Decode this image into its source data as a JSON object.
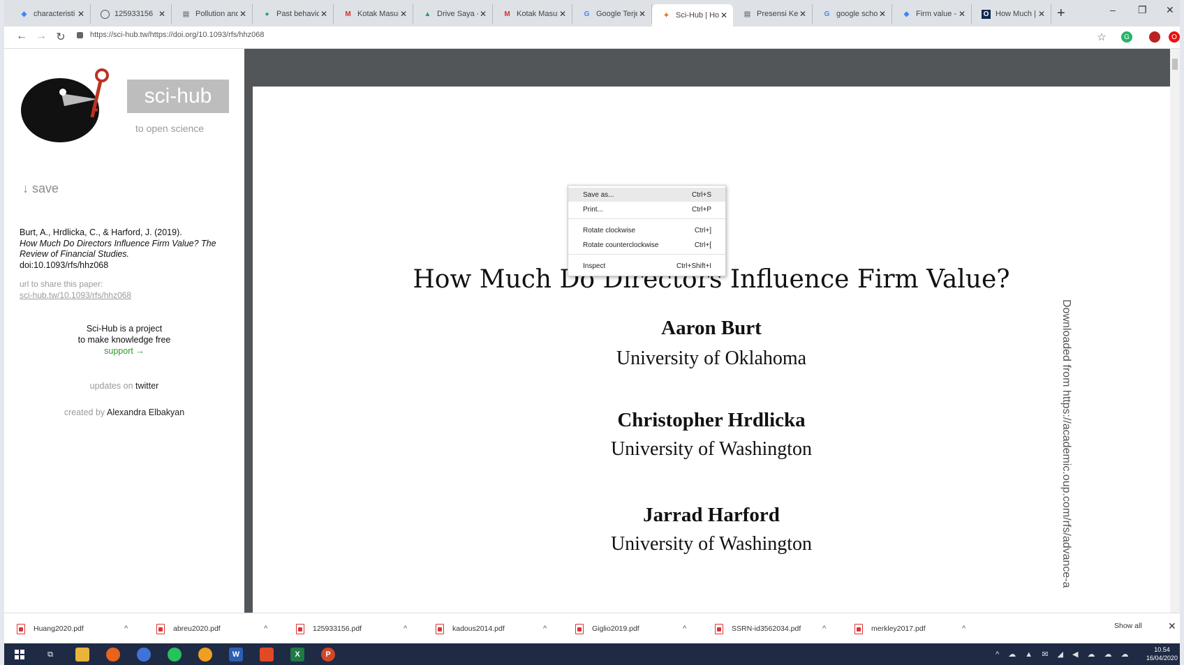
{
  "browser": {
    "tabs": [
      {
        "label": "characteristi",
        "icon": "diamond-icon",
        "color": "#4285f4",
        "active": false
      },
      {
        "label": "125933156",
        "icon": "globe-icon",
        "color": "#555555",
        "active": false
      },
      {
        "label": "Pollution and",
        "icon": "document-icon",
        "color": "#888888",
        "active": false
      },
      {
        "label": "Past behavio",
        "icon": "leaf-icon",
        "color": "#2a9d8f",
        "active": false
      },
      {
        "label": "Kotak Masuk",
        "icon": "gmail-icon",
        "color": "#d93025",
        "active": false
      },
      {
        "label": "Drive Saya -",
        "icon": "drive-icon",
        "color": "#1fa463",
        "active": false
      },
      {
        "label": "Kotak Masuk",
        "icon": "gmail-icon",
        "color": "#d93025",
        "active": false
      },
      {
        "label": "Google Terje",
        "icon": "translate-icon",
        "color": "#4285f4",
        "active": false
      },
      {
        "label": "Sci-Hub | Ho",
        "icon": "scihub-icon",
        "color": "#e06c2b",
        "active": true
      },
      {
        "label": "Presensi Kel",
        "icon": "document-icon",
        "color": "#888888",
        "active": false
      },
      {
        "label": "google scho",
        "icon": "google-icon",
        "color": "#4285f4",
        "active": false
      },
      {
        "label": "Firm value -",
        "icon": "diamond-icon",
        "color": "#4285f4",
        "active": false
      },
      {
        "label": "How Much |",
        "icon": "oxford-icon",
        "color": "#102a4f",
        "active": false
      }
    ],
    "url": "https://sci-hub.tw/https://doi.org/10.1093/rfs/hhz068"
  },
  "sidebar": {
    "logo_text": "sci-hub",
    "tagline": "to open science",
    "save_label": "↓ save",
    "citation": {
      "line1": "Burt, A., Hrdlicka, C., & Harford, J. (2019).",
      "title": "How Much Do Directors Influence Firm Value? The Review of Financial Studies.",
      "doi": "doi:10.1093/rfs/hhz068"
    },
    "share_label": "url to share this paper:",
    "share_url": "sci-hub.tw/10.1093/rfs/hhz068",
    "project_line1": "Sci-Hub is a project",
    "project_line2": "to make knowledge free",
    "support": "support →",
    "updates_prefix": "updates on",
    "updates_link": "twitter",
    "created_prefix": "created by",
    "created_link": "Alexandra Elbakyan"
  },
  "pdf": {
    "title": "How Much Do Directors Influence Firm Value?",
    "authors": [
      {
        "name": "Aaron Burt",
        "affiliation": "University of Oklahoma"
      },
      {
        "name": "Christopher Hrdlicka",
        "affiliation": "University of Washington"
      },
      {
        "name": "Jarrad Harford",
        "affiliation": "University of Washington"
      }
    ],
    "watermark": "Downloaded from https://academic.oup.com/rfs/advance-a"
  },
  "context_menu": {
    "items": [
      {
        "label": "Save as...",
        "shortcut": "Ctrl+S"
      },
      {
        "label": "Print...",
        "shortcut": "Ctrl+P"
      },
      {
        "label": "Rotate clockwise",
        "shortcut": "Ctrl+]"
      },
      {
        "label": "Rotate counterclockwise",
        "shortcut": "Ctrl+["
      },
      {
        "label": "Inspect",
        "shortcut": "Ctrl+Shift+I"
      }
    ]
  },
  "downloads": {
    "items": [
      "Huang2020.pdf",
      "abreu2020.pdf",
      "125933156.pdf",
      "kadous2014.pdf",
      "Giglio2019.pdf",
      "SSRN-id3562034.pdf",
      "merkley2017.pdf"
    ],
    "show_all": "Show all"
  },
  "taskbar": {
    "time": "10.54",
    "date": "16/04/2020"
  }
}
